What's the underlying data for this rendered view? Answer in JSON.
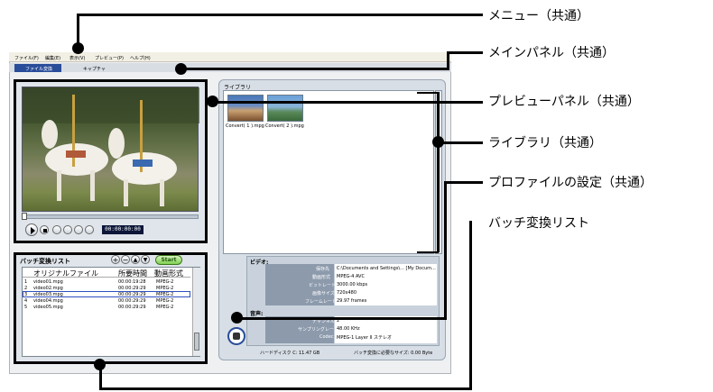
{
  "callouts": {
    "menu": "メニュー（共通）",
    "main_panel": "メインパネル（共通）",
    "preview_panel": "プレビューパネル（共通）",
    "library": "ライブラリ（共通）",
    "profile": "プロファイルの設定（共通）",
    "batch_list": "バッチ変換リスト"
  },
  "menu": {
    "items": [
      "ファイル(F)",
      "編集(E)",
      "表示(V)",
      "プレビュー(P)",
      "ヘルプ(H)"
    ]
  },
  "tabs": [
    "ファイル変換",
    "キャプチャ"
  ],
  "preview": {
    "timecode": "00:00:00:00"
  },
  "batch": {
    "title": "バッチ変換リスト",
    "start_label": "Start",
    "columns": [
      "オリジナルファイル",
      "所要時間",
      "動画形式"
    ],
    "rows": [
      {
        "num": "1",
        "file": "video01.mpg",
        "duration": "00:00:19:28",
        "format": "MPEG-2"
      },
      {
        "num": "2",
        "file": "video02.mpg",
        "duration": "00:00:29:29",
        "format": "MPEG-2"
      },
      {
        "num": "3",
        "file": "video03.mpg",
        "duration": "00:00:29:29",
        "format": "MPEG-2"
      },
      {
        "num": "4",
        "file": "video04.mpg",
        "duration": "00:00:29:29",
        "format": "MPEG-2"
      },
      {
        "num": "5",
        "file": "video05.mpg",
        "duration": "00:00:29:29",
        "format": "MPEG-2"
      }
    ]
  },
  "library": {
    "title": "ライブラリ",
    "thumbs": [
      "Convert( 1 ).mpg",
      "Convert( 2 ).mpg"
    ]
  },
  "profile": {
    "video_heading": "ビデオ:",
    "audio_heading": "音声:",
    "video_rows": [
      {
        "label": "保存先",
        "value": "C:\\Documents and Settings\\... [My Docum..."
      },
      {
        "label": "動画形式",
        "value": "MPEG-4 AVC"
      },
      {
        "label": "ビットレート",
        "value": "3000.00 kbps"
      },
      {
        "label": "画像サイズ",
        "value": "720x480"
      },
      {
        "label": "フレームレート",
        "value": "29.97 frames"
      }
    ],
    "audio_rows": [
      {
        "label": "チャンネル",
        "value": "2"
      },
      {
        "label": "サンプリングレート",
        "value": "48.00 KHz"
      },
      {
        "label": "Codec",
        "value": "MPEG-1 Layer II ステレオ"
      }
    ],
    "disk": "ハードディスク C: 11.47 GB",
    "required": "バッチ変換に必要なサイズ: 0.00 Byte"
  },
  "colors": {
    "panel_bg": "#d7dee6",
    "accent_blue": "#2a4d9a",
    "selected_row": "#3050c0"
  }
}
